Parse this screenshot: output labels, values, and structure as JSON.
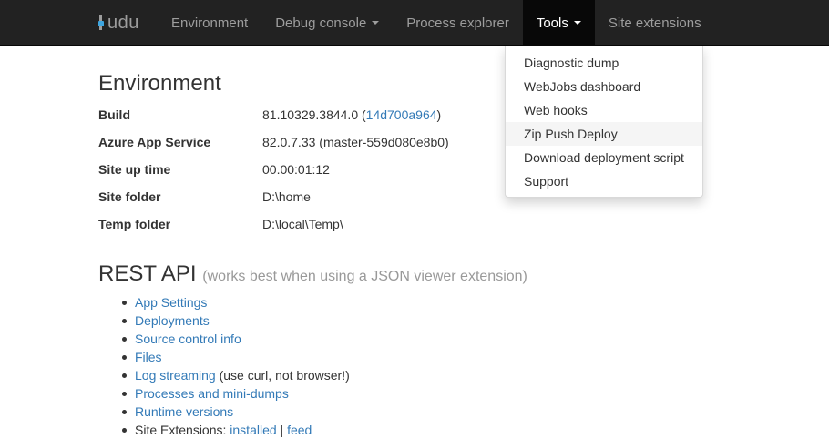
{
  "brand": {
    "label": "kudu"
  },
  "nav": {
    "items": [
      {
        "label": "Environment",
        "has_caret": false
      },
      {
        "label": "Debug console",
        "has_caret": true
      },
      {
        "label": "Process explorer",
        "has_caret": false
      },
      {
        "label": "Tools",
        "has_caret": true,
        "active": true
      },
      {
        "label": "Site extensions",
        "has_caret": false
      }
    ]
  },
  "tools_menu": {
    "items": [
      "Diagnostic dump",
      "WebJobs dashboard",
      "Web hooks",
      "Zip Push Deploy",
      "Download deployment script",
      "Support"
    ],
    "hovered": "Zip Push Deploy"
  },
  "environment": {
    "title": "Environment",
    "rows": [
      {
        "label": "Build",
        "value_prefix": "81.10329.3844.0 (",
        "link": "14d700a964",
        "value_suffix": ")"
      },
      {
        "label": "Azure App Service",
        "value": "82.0.7.33 (master-559d080e8b0)"
      },
      {
        "label": "Site up time",
        "value": "00.00:01:12"
      },
      {
        "label": "Site folder",
        "value": "D:\\home"
      },
      {
        "label": "Temp folder",
        "value": "D:\\local\\Temp\\"
      }
    ]
  },
  "rest_api": {
    "title": "REST API",
    "hint": "(works best when using a JSON viewer extension)",
    "items": [
      {
        "link": "App Settings"
      },
      {
        "link": "Deployments"
      },
      {
        "link": "Source control info"
      },
      {
        "link": "Files"
      },
      {
        "link": "Log streaming",
        "note": " (use curl, not browser!)"
      },
      {
        "link": "Processes and mini-dumps"
      },
      {
        "link": "Runtime versions"
      },
      {
        "prefix": "Site Extensions: ",
        "link": "installed",
        "separator": " | ",
        "link2": "feed"
      }
    ]
  },
  "colors": {
    "navbar_bg": "#222222",
    "nav_text": "#9d9d9d",
    "active_bg": "#080808",
    "link": "#337ab7",
    "brand_accent": "#3ea6e0"
  }
}
